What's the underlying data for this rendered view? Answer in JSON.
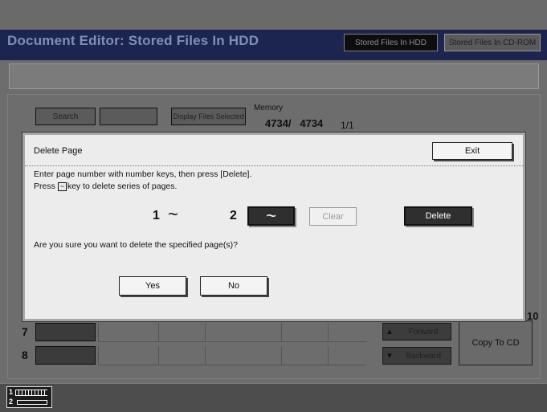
{
  "window": {
    "title": "Document Editor: Stored Files In HDD",
    "tabs": [
      {
        "label": "Stored Files In HDD",
        "selected": true
      },
      {
        "label": "Stored Files In CD-ROM",
        "selected": false
      }
    ]
  },
  "toolbar": {
    "search_label": "Search",
    "display_selected_label": "Display Files Selected",
    "memory_label": "Memory",
    "memory_value": "4734/   4734",
    "page_indicator": "1/1"
  },
  "rows": [
    {
      "number": "7"
    },
    {
      "number": "8"
    }
  ],
  "nav": {
    "forward_label": "Forward",
    "backward_label": "Backward",
    "copy_to_cd_label": "Copy To CD",
    "partial_number": "10"
  },
  "dialog": {
    "title": "Delete Page",
    "exit_label": "Exit",
    "instruction_line1": "Enter page number with number keys, then press [Delete].",
    "instruction_line2_pre": "Press",
    "instruction_line2_key": "~",
    "instruction_line2_post": "key to delete series of pages.",
    "from_page": "1",
    "range_symbol": "~",
    "to_page": "2",
    "range_button_symbol": "~",
    "clear_label": "Clear",
    "delete_label": "Delete",
    "confirm_text": "Are you sure you want to delete the specified page(s)?",
    "yes_label": "Yes",
    "no_label": "No"
  },
  "status": {
    "tray1_label": "1",
    "tray2_label": "2"
  }
}
